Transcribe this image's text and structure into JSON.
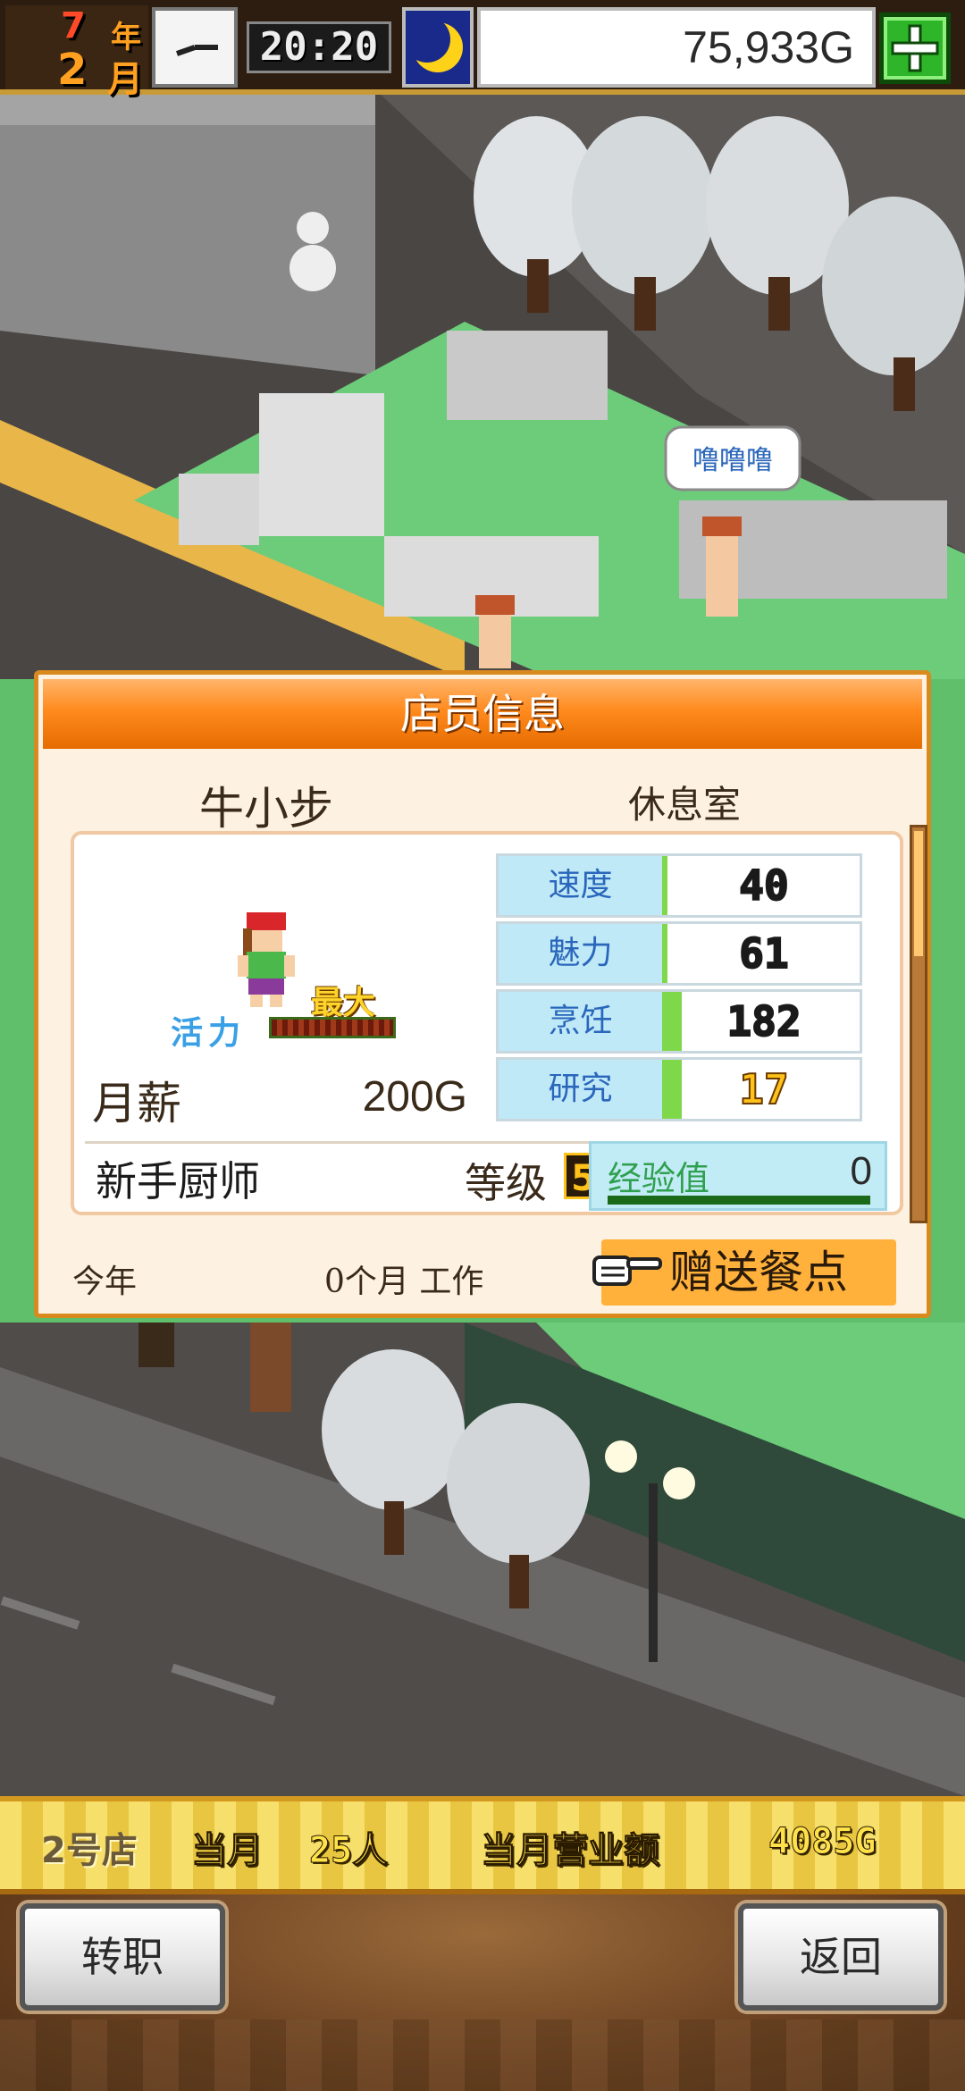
{
  "hud": {
    "year_number": "7",
    "year_unit": "年",
    "month_number": "2",
    "month_unit": "月",
    "time": "20:20",
    "money": "75,933G"
  },
  "scene": {
    "speech_bubble": "噜噜噜"
  },
  "dialog": {
    "title": "店员信息",
    "staff_name": "牛小步",
    "location": "休息室",
    "energy_label": "活力",
    "energy_max_label": "最大",
    "salary_label": "月薪",
    "salary_value": "200G",
    "stats": [
      {
        "label": "速度",
        "value": "40",
        "fill": 0.02
      },
      {
        "label": "魅力",
        "value": "61",
        "fill": 0.02
      },
      {
        "label": "烹饪",
        "value": "182",
        "fill": 0.1
      },
      {
        "label": "研究",
        "value": "17",
        "fill": 0.1
      }
    ],
    "rank_title": "新手厨师",
    "level_label": "等级",
    "level_value": "5",
    "exp_label": "经验值",
    "exp_value": "0",
    "footer_this_year": "今年",
    "footer_work": "0个月 工作",
    "gift_button": "赠送餐点"
  },
  "status_bar": {
    "shop": "2号店",
    "month_label": "当月",
    "customers": "25人",
    "sales_label": "当月营业额",
    "sales_value": "4085G"
  },
  "buttons": {
    "transfer": "转职",
    "back": "返回"
  }
}
